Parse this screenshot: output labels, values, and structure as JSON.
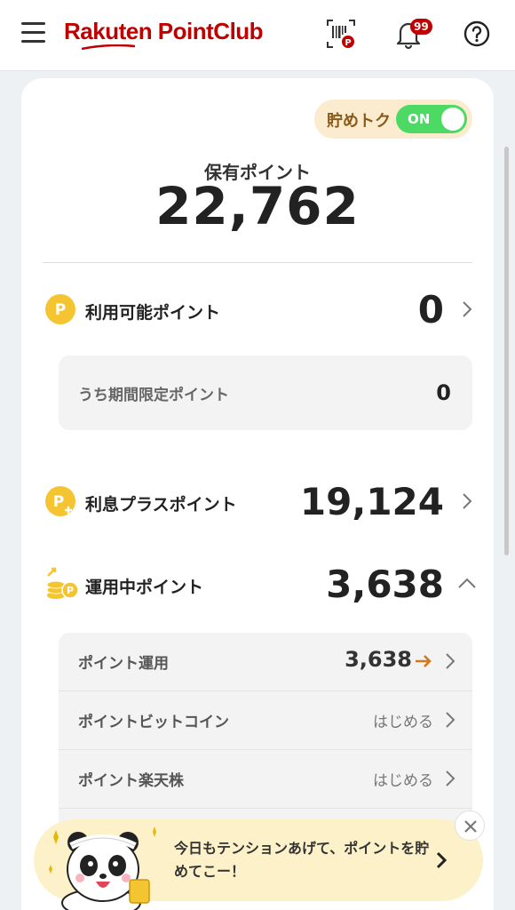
{
  "header": {
    "logo": "Rakuten PointClub",
    "notification_badge": "99"
  },
  "toggle": {
    "label": "貯めトク",
    "state": "ON"
  },
  "held": {
    "label": "保有ポイント",
    "value": "22,762"
  },
  "available": {
    "label": "利用可能ポイント",
    "value": "0",
    "limited_label": "うち期間限定ポイント",
    "limited_value": "0"
  },
  "interest": {
    "label": "利息プラスポイント",
    "value": "19,124"
  },
  "investing": {
    "label": "運用中ポイント",
    "value": "3,638",
    "items": [
      {
        "label": "ポイント運用",
        "right": "3,638"
      },
      {
        "label": "ポイントビットコイン",
        "right": "はじめる"
      },
      {
        "label": "ポイント楽天株",
        "right": "はじめる"
      }
    ]
  },
  "banner": {
    "text": "今日もテンションあげて、ポイントを貯めてこー！"
  },
  "colors": {
    "brand": "#bf0000",
    "toggle_on": "#4cd964",
    "point_gold": "#f5c431",
    "banner_bg": "#fdf1c9"
  }
}
